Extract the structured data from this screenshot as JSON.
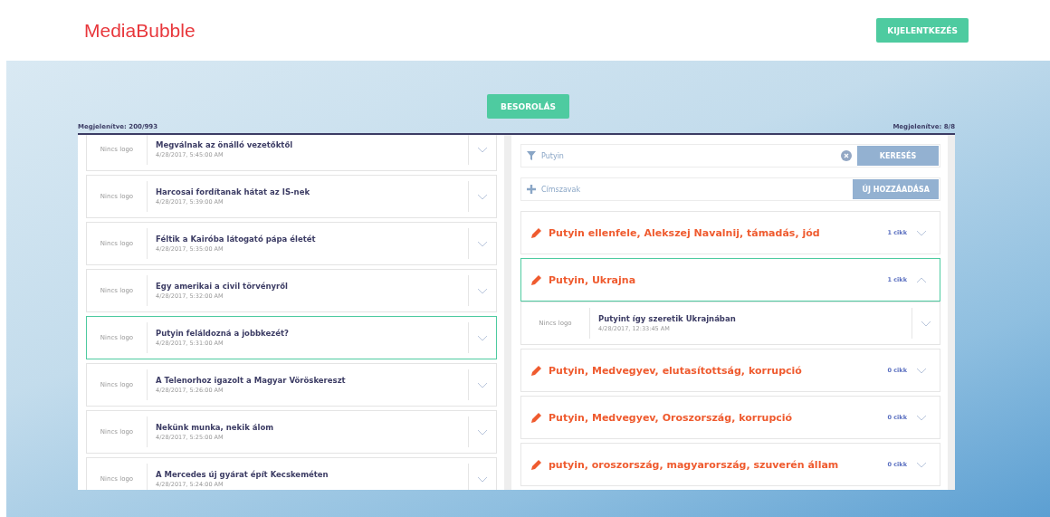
{
  "header": {
    "logo": "MediaBubble",
    "logout_button": "KIJELENTKEZÉS"
  },
  "classify_button": "BESOROLÁS",
  "left_panel": {
    "shown": "Megjelenítve: 200/993",
    "articles": [
      {
        "logo": "Nincs logo",
        "title": "Megválnak az önálló vezetőktől",
        "date": "4/28/2017, 5:45:00 AM",
        "selected": false
      },
      {
        "logo": "Nincs logo",
        "title": "Harcosai fordítanak hátat az IS-nek",
        "date": "4/28/2017, 5:39:00 AM",
        "selected": false
      },
      {
        "logo": "Nincs logo",
        "title": "Féltik a Kairóba látogató pápa életét",
        "date": "4/28/2017, 5:35:00 AM",
        "selected": false
      },
      {
        "logo": "Nincs logo",
        "title": "Egy amerikai a civil törvényről",
        "date": "4/28/2017, 5:32:00 AM",
        "selected": false
      },
      {
        "logo": "Nincs logo",
        "title": "Putyin feláldozná a jobbkezét?",
        "date": "4/28/2017, 5:31:00 AM",
        "selected": true
      },
      {
        "logo": "Nincs logo",
        "title": "A Telenorhoz igazolt a Magyar Vöröskereszt",
        "date": "4/28/2017, 5:26:00 AM",
        "selected": false
      },
      {
        "logo": "Nincs logo",
        "title": "Nekünk munka, nekik álom",
        "date": "4/28/2017, 5:25:00 AM",
        "selected": false
      },
      {
        "logo": "Nincs logo",
        "title": "A Mercedes új gyárat épít Kecskeméten",
        "date": "4/28/2017, 5:24:00 AM",
        "selected": false
      }
    ]
  },
  "right_panel": {
    "shown": "Megjelenítve: 8/8",
    "search": {
      "value": "Putyin",
      "button": "KERESÉS"
    },
    "keywords": {
      "placeholder": "Címszavak",
      "button": "ÚJ HOZZÁADÁSA"
    },
    "groups": [
      {
        "title": "Putyin ellenfele, Alekszej Navalnij, támadás, jód",
        "count": "1 cikk",
        "expanded": false
      },
      {
        "title": "Putyin, Ukrajna",
        "count": "1 cikk",
        "expanded": true,
        "articles": [
          {
            "logo": "Nincs logo",
            "title": "Putyint így szeretik Ukrajnában",
            "date": "4/28/2017, 12:33:45 AM"
          }
        ]
      },
      {
        "title": "Putyin, Medvegyev, elutasítottság, korrupció",
        "count": "0 cikk",
        "expanded": false
      },
      {
        "title": "Putyin, Medvegyev, Oroszország, korrupció",
        "count": "0 cikk",
        "expanded": false
      },
      {
        "title": "putyin, oroszország, magyarország, szuverén állam",
        "count": "0 cikk",
        "expanded": false
      }
    ]
  }
}
